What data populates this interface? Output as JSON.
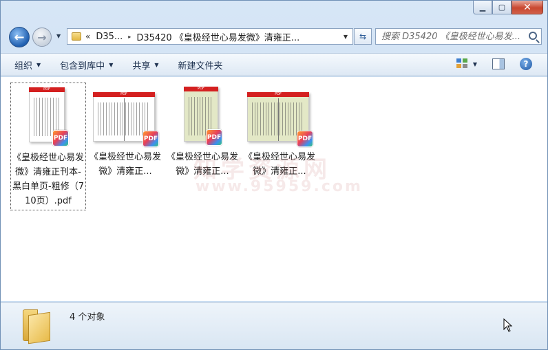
{
  "window": {
    "min_glyph": "▁",
    "max_glyph": "▢",
    "close_glyph": "✕"
  },
  "nav": {
    "back_glyph": "←",
    "forward_glyph": "→",
    "dropdown_glyph": "▼"
  },
  "address": {
    "chevrons": "«",
    "crumb_1": "D35...",
    "separator": "▸",
    "crumb_2": "D35420 《皇极经世心易发微》清雍正...",
    "dropdown_glyph": "▼"
  },
  "refresh_glyph": "⇆",
  "search": {
    "placeholder": "搜索 D35420 《皇极经世心易发..."
  },
  "toolbar": {
    "organize": "组织",
    "include_in_library": "包含到库中",
    "share": "共享",
    "new_folder": "新建文件夹",
    "arrow": "▼",
    "help_glyph": "?"
  },
  "files": [
    {
      "label": "《皇极经世心易发微》清雍正刊本-黑白单页-粗修（710页）.pdf",
      "badge": "PDF",
      "bar": "PDF"
    },
    {
      "label": "《皇极经世心易发微》清雍正...",
      "badge": "PDF",
      "bar": "PDF"
    },
    {
      "label": "《皇极经世心易发微》清雍正...",
      "badge": "PDF",
      "bar": "PDF"
    },
    {
      "label": "《皇极经世心易发微》清雍正...",
      "badge": "PDF",
      "bar": "PDF"
    }
  ],
  "watermark": {
    "line1": "知学资源网",
    "line2": "www.95959.com"
  },
  "status": {
    "count_text": "4 个对象"
  },
  "colors": {
    "pdf_bar": "#d42020",
    "window_frame": "#6f8fb5",
    "close_button": "#c9472f"
  }
}
